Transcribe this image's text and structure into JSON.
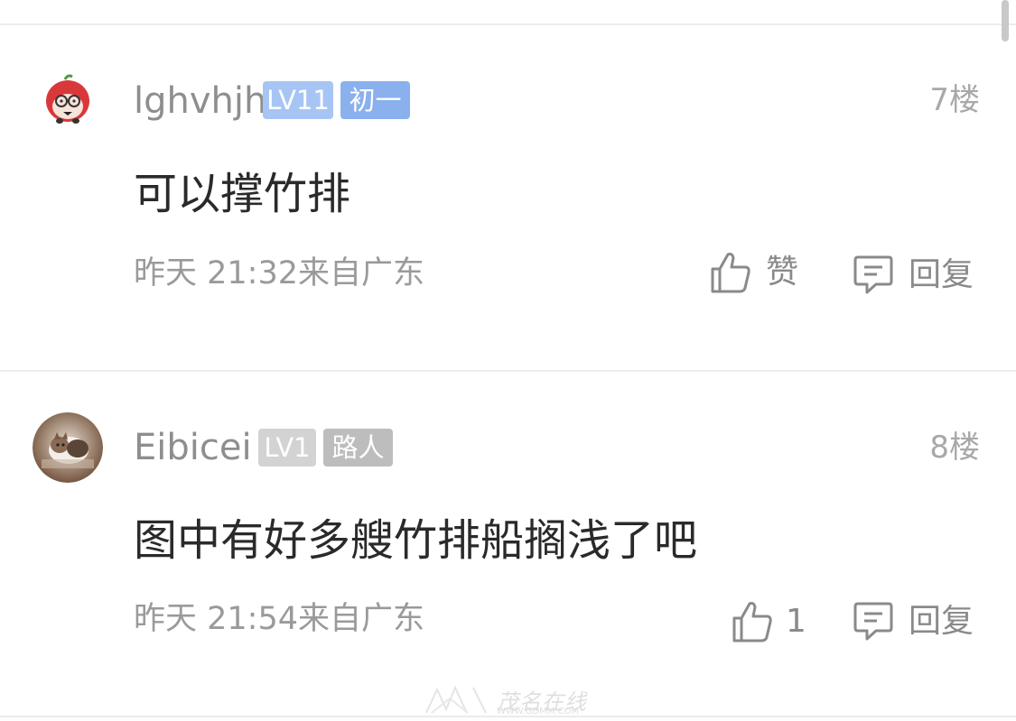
{
  "comments": [
    {
      "username": "lghvhjh",
      "level_badge": "LV11",
      "title_badge": "初一",
      "floor": "7楼",
      "text": "可以撑竹排",
      "meta": "昨天 21:32来自广东",
      "like_label": "赞",
      "reply_label": "回复"
    },
    {
      "username": "Eibicei",
      "level_badge": "LV1",
      "title_badge": "路人",
      "floor": "8楼",
      "text": "图中有好多艘竹排船搁浅了吧",
      "meta": "昨天 21:54来自广东",
      "like_label": "1",
      "reply_label": "回复"
    }
  ],
  "watermark": {
    "text": "茂名在线",
    "url": "WWW.GDMM.COM"
  },
  "colors": {
    "badge_blue": "#9bbdf2",
    "badge_blue_dark": "#8ab0ee",
    "badge_gray": "#cfcfcf",
    "badge_gray_dark": "#bdbdbd",
    "divider": "#ececec"
  },
  "icons": {
    "like": "thumbs-up-icon",
    "reply": "comment-bubble-icon"
  }
}
